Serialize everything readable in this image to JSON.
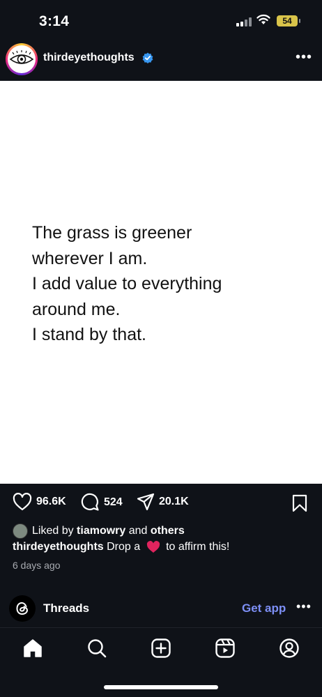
{
  "status_bar": {
    "time": "3:14",
    "battery": "54"
  },
  "post": {
    "username": "thirdeyethoughts",
    "text_lines": [
      "The grass is greener",
      "wherever I am.",
      "I add value to everything",
      "around me.",
      "I stand by that."
    ],
    "likes": "96.6K",
    "comments": "524",
    "shares": "20.1K",
    "liked_by_prefix": "Liked by",
    "liked_by_user": "tiamowry",
    "liked_by_and": "and",
    "liked_by_others": "others",
    "caption_user": "thirdeyethoughts",
    "caption_before": "Drop a",
    "caption_after": "to affirm this!",
    "time_ago": "6 days ago"
  },
  "threads_banner": {
    "label": "Threads",
    "action": "Get app"
  },
  "colors": {
    "background": "#0f1218",
    "link_blue": "#7d8ff5",
    "verified_blue": "#3897f0",
    "heart_red": "#e0245e"
  },
  "icons": [
    "heart-icon",
    "comment-icon",
    "share-icon",
    "bookmark-icon",
    "home-icon",
    "search-icon",
    "create-icon",
    "reels-icon",
    "profile-icon",
    "threads-icon",
    "more-icon",
    "verified-icon"
  ]
}
